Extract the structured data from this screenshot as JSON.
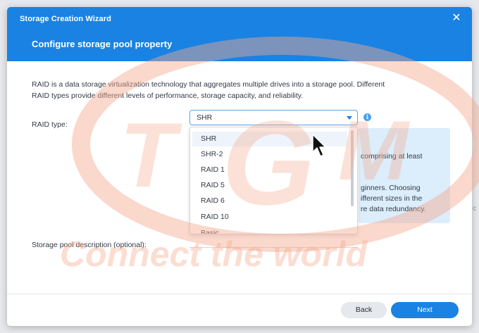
{
  "window": {
    "title": "Storage Creation Wizard",
    "close_icon": "close-icon",
    "page_title": "Configure storage pool property"
  },
  "intro": {
    "line1": "RAID is a data storage virtualization technology that aggregates multiple drives into a storage pool. Different",
    "line2": "RAID types provide different levels of performance, storage capacity, and reliability."
  },
  "raid_type": {
    "label": "RAID type:",
    "selected": "SHR",
    "info_icon": "info-icon",
    "options": [
      "SHR",
      "SHR-2",
      "RAID 1",
      "RAID 5",
      "RAID 6",
      "RAID 10",
      "Basic"
    ]
  },
  "info_panel": {
    "line1": "comprising at least",
    "line2": "ginners. Choosing",
    "line3": "ifferent sizes in the",
    "line4": "re data redundancy."
  },
  "pool_description": {
    "label": "Storage pool description (optional):",
    "value": ""
  },
  "footer": {
    "back_label": "Back",
    "next_label": "Next"
  },
  "watermark": {
    "text": "Connect the world",
    "color": "#f4a98d"
  },
  "colors": {
    "accent": "#1a82e2",
    "info_bg": "#dcedfb"
  }
}
